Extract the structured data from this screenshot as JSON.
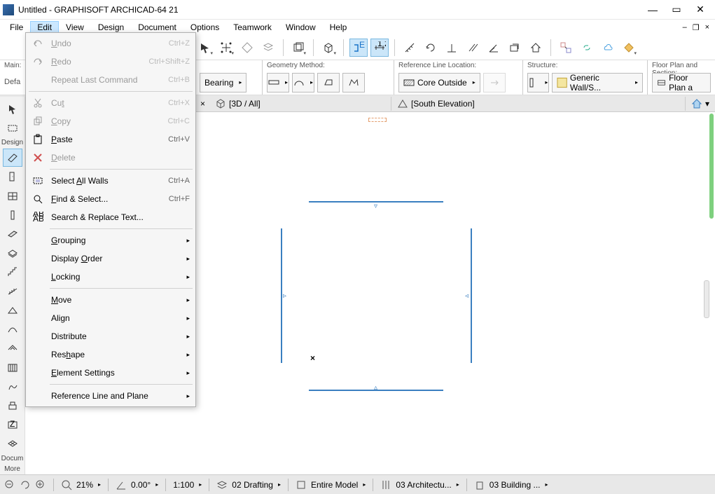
{
  "title": "Untitled - GRAPHISOFT ARCHICAD-64 21",
  "menus": [
    "File",
    "Edit",
    "View",
    "Design",
    "Document",
    "Options",
    "Teamwork",
    "Window",
    "Help"
  ],
  "labels": {
    "main": "Main:",
    "defa": "Defa",
    "design": "Design",
    "docum": "Docum",
    "more": "More"
  },
  "panelHeaders": {
    "geom": "Geometry Method:",
    "ref": "Reference Line Location:",
    "struct": "Structure:",
    "floor": "Floor Plan and Section:"
  },
  "panelValues": {
    "bearing": "Bearing",
    "core": "Core Outside",
    "wall": "Generic Wall/S...",
    "floor": "Floor Plan a"
  },
  "tabs": {
    "t3d": "[3D / All]",
    "south": "[South Elevation]"
  },
  "editMenu": [
    {
      "icon": "undo",
      "label": "Undo",
      "sc": "Ctrl+Z",
      "dis": true,
      "u": "U"
    },
    {
      "icon": "redo",
      "label": "Redo",
      "sc": "Ctrl+Shift+Z",
      "dis": true,
      "u": "R"
    },
    {
      "icon": "",
      "label": "Repeat Last Command",
      "sc": "Ctrl+B",
      "dis": true
    },
    {
      "sep": true,
      "full": true
    },
    {
      "icon": "cut",
      "label": "Cut",
      "sc": "Ctrl+X",
      "dis": true,
      "u": "t"
    },
    {
      "icon": "copy",
      "label": "Copy",
      "sc": "Ctrl+C",
      "dis": true,
      "u": "C"
    },
    {
      "icon": "paste",
      "label": "Paste",
      "sc": "Ctrl+V",
      "u": "P"
    },
    {
      "icon": "del",
      "label": "Delete",
      "dis": true,
      "u": "D"
    },
    {
      "sep": true
    },
    {
      "icon": "selall",
      "label": "Select All Walls",
      "sc": "Ctrl+A",
      "u": "A"
    },
    {
      "icon": "find",
      "label": "Find & Select...",
      "sc": "Ctrl+F",
      "u": "F"
    },
    {
      "icon": "sr",
      "label": "Search & Replace Text..."
    },
    {
      "sep": true
    },
    {
      "label": "Grouping",
      "sub": true,
      "u": "G"
    },
    {
      "label": "Display Order",
      "sub": true,
      "u": "O"
    },
    {
      "label": "Locking",
      "sub": true,
      "u": "L"
    },
    {
      "sep": true
    },
    {
      "label": "Move",
      "sub": true,
      "u": "M"
    },
    {
      "label": "Align",
      "sub": true
    },
    {
      "label": "Distribute",
      "sub": true
    },
    {
      "label": "Reshape",
      "sub": true,
      "u": "h"
    },
    {
      "label": "Element Settings",
      "sub": true,
      "u": "E"
    },
    {
      "sep": true
    },
    {
      "label": "Reference Line and Plane",
      "sub": true
    }
  ],
  "status": {
    "zoom": "21%",
    "angle": "0.00°",
    "scale": "1:100",
    "drafting": "02 Drafting",
    "model": "Entire Model",
    "arch": "03 Architectu...",
    "bldg": "03 Building ..."
  }
}
